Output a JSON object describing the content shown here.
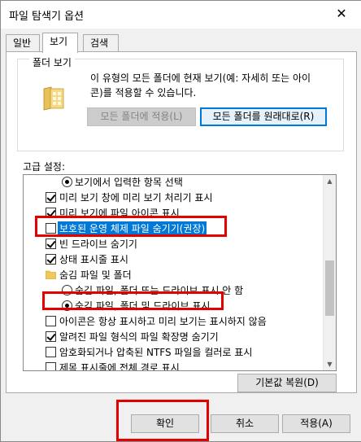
{
  "window": {
    "title": "파일 탐색기 옵션",
    "close_glyph": "✕"
  },
  "tabs": [
    {
      "label": "일반",
      "active": false
    },
    {
      "label": "보기",
      "active": true
    },
    {
      "label": "검색",
      "active": false
    }
  ],
  "folder_views": {
    "group_label": "폴더 보기",
    "description_line1": "이 유형의 모든 폴더에 현재 보기(예: 자세히 또는 아이",
    "description_line2": "콘)를 적용할 수 있습니다.",
    "apply_button": "모든 폴더에 적용(L)",
    "reset_button": "모든 폴더를 원래대로(R)",
    "icon": "folder-icon"
  },
  "advanced": {
    "label": "고급 설정:",
    "items": [
      {
        "type": "radio",
        "checked": true,
        "indent": 2,
        "label": "보기에서 입력한 항목 선택"
      },
      {
        "type": "checkbox",
        "checked": true,
        "indent": 1,
        "label": "미리 보기 창에 미리 보기 처리기 표시"
      },
      {
        "type": "checkbox",
        "checked": true,
        "indent": 1,
        "label": "미리 보기에 파일 아이콘 표시"
      },
      {
        "type": "checkbox",
        "checked": false,
        "indent": 1,
        "label": "보호된 운영 체제 파일 숨기기(권장)",
        "selected": true
      },
      {
        "type": "checkbox",
        "checked": true,
        "indent": 1,
        "label": "빈 드라이브 숨기기"
      },
      {
        "type": "checkbox",
        "checked": true,
        "indent": 1,
        "label": "상태 표시줄 표시"
      },
      {
        "type": "folder",
        "indent": 1,
        "label": "숨김 파일 및 폴더"
      },
      {
        "type": "radio",
        "checked": false,
        "indent": 2,
        "label": "숨김 파일, 폴더 또는 드라이브 표시 안 함"
      },
      {
        "type": "radio",
        "checked": true,
        "indent": 2,
        "label": "숨김 파일, 폴더 및 드라이브 표시"
      },
      {
        "type": "checkbox",
        "checked": false,
        "indent": 1,
        "label": "아이콘은 항상 표시하고 미리 보기는 표시하지 않음"
      },
      {
        "type": "checkbox",
        "checked": true,
        "indent": 1,
        "label": "알려진 파일 형식의 파일 확장명 숨기기"
      },
      {
        "type": "checkbox",
        "checked": false,
        "indent": 1,
        "label": "암호화되거나 압축된 NTFS 파일을 컬러로 표시"
      },
      {
        "type": "checkbox",
        "checked": false,
        "indent": 1,
        "label": "제목 표시줄에 전체 경로 표시"
      }
    ]
  },
  "buttons": {
    "restore": "기본값 복원(D)",
    "ok": "확인",
    "cancel": "취소",
    "apply": "적용(A)"
  },
  "colors": {
    "accent": "#0078d7",
    "highlight_box": "#e50000"
  }
}
